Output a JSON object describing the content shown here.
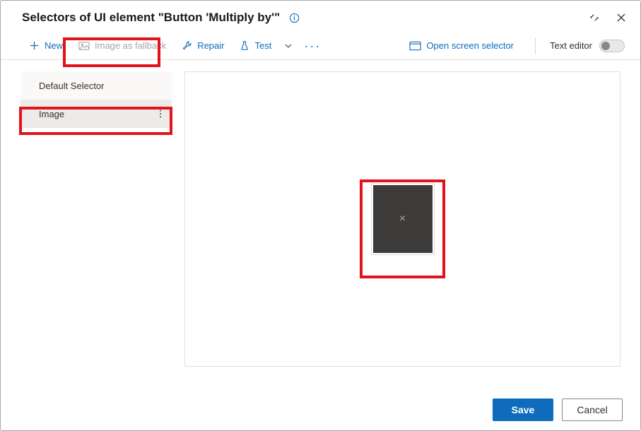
{
  "header": {
    "title": "Selectors of UI element \"Button 'Multiply by'\""
  },
  "toolbar": {
    "new_label": "New",
    "image_fallback_label": "Image as fallback",
    "repair_label": "Repair",
    "test_label": "Test",
    "open_screen_selector_label": "Open screen selector",
    "text_editor_label": "Text editor"
  },
  "selectors": {
    "items": [
      {
        "label": "Default Selector"
      },
      {
        "label": "Image"
      }
    ]
  },
  "preview": {
    "glyph": "×"
  },
  "footer": {
    "save_label": "Save",
    "cancel_label": "Cancel"
  }
}
